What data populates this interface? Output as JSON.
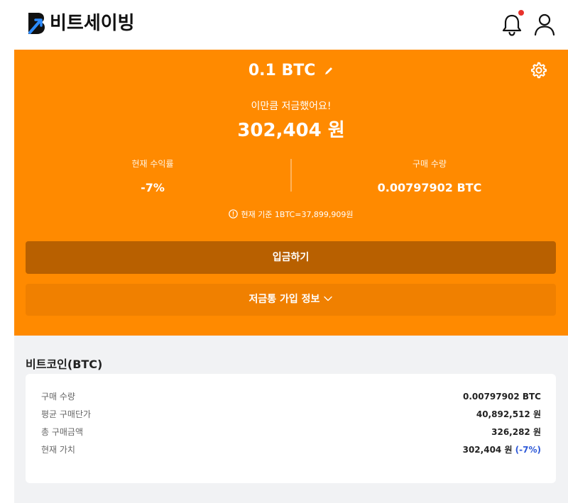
{
  "header": {
    "logo_text": "비트세이빙",
    "bell_icon": "bell-icon",
    "user_icon": "user-icon",
    "accent_color": "#ff8a00",
    "notification_dot_color": "#e8322b"
  },
  "savings": {
    "amount": "0.1 BTC",
    "saved_message": "이만큼 저금했어요!",
    "saved_amount": "302,404 원",
    "return_label": "현재 수익률",
    "return_value": "-7%",
    "quantity_label": "구매 수량",
    "quantity_value": "0.00797902 BTC",
    "rate_note": "현재 기준 1BTC=37,899,909원",
    "deposit_button": "입금하기",
    "info_button": "저금통 가입 정보"
  },
  "detail": {
    "title": "비트코인(BTC)",
    "rows": [
      {
        "label": "구매 수량",
        "value": "0.00797902 BTC",
        "extra": ""
      },
      {
        "label": "평균 구매단가",
        "value": "40,892,512 원",
        "extra": ""
      },
      {
        "label": "총 구매금액",
        "value": "326,282 원",
        "extra": ""
      },
      {
        "label": "현재 가치",
        "value": "302,404 원",
        "extra": "(-7%)"
      }
    ],
    "negative_color": "#2f5ad8"
  }
}
